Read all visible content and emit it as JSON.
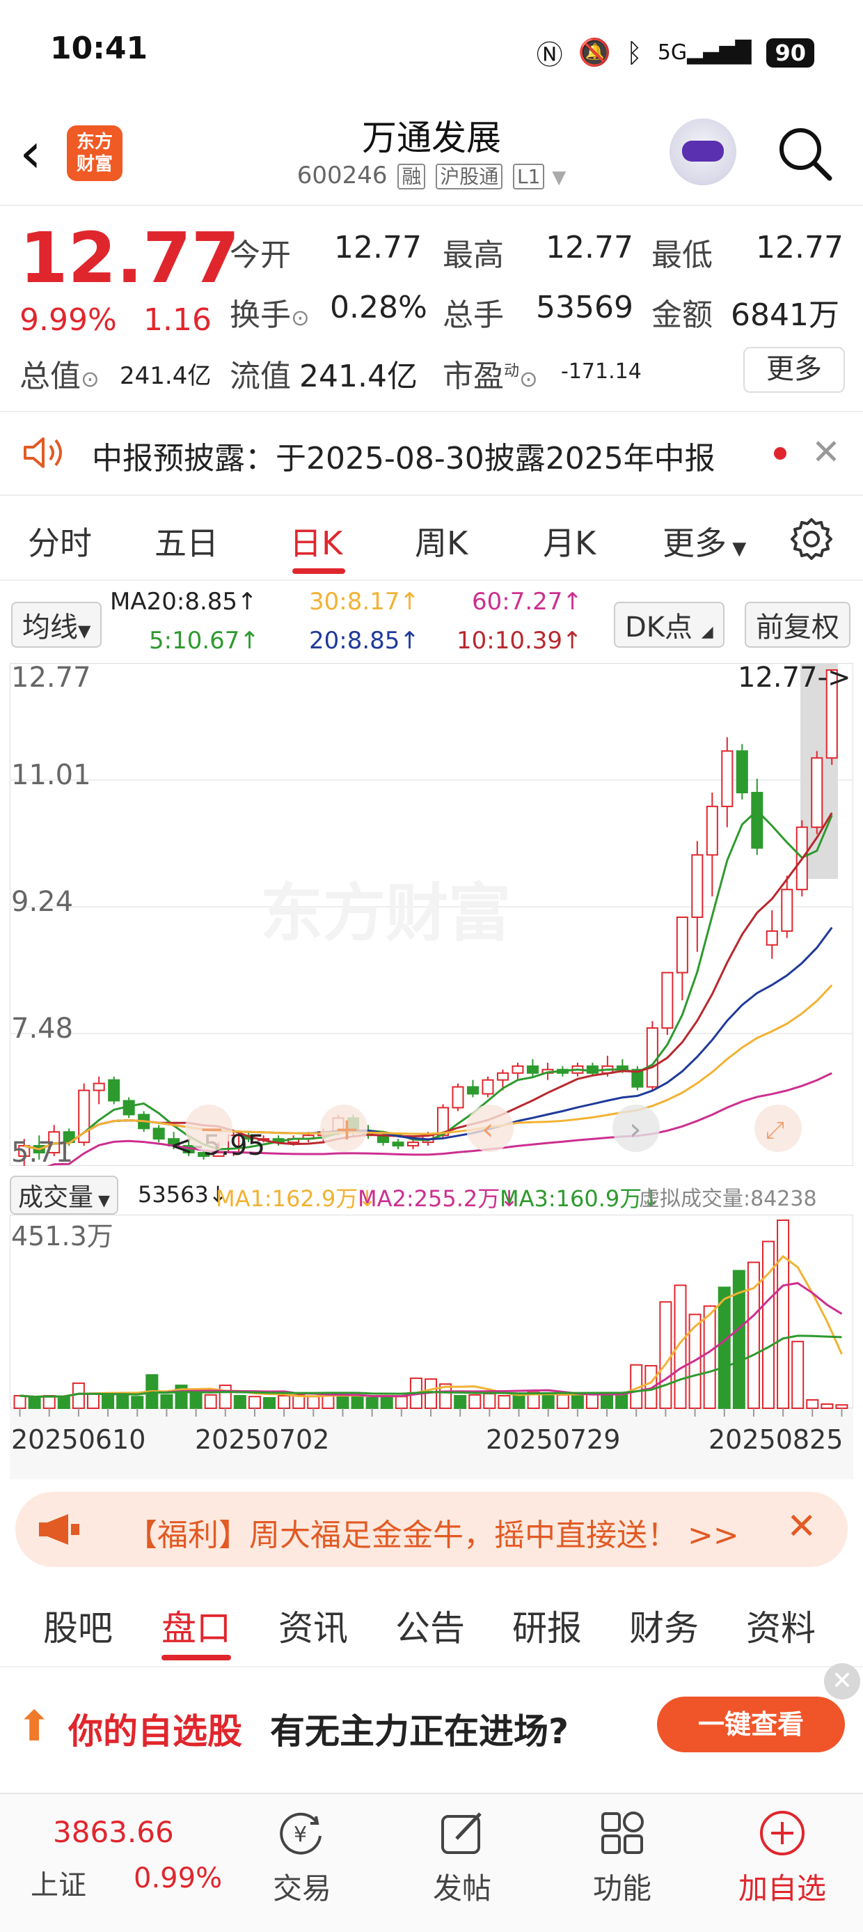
{
  "status_bar": {
    "time": "10:41",
    "network": "5G",
    "battery": "90"
  },
  "header": {
    "title": "万通发展",
    "code": "600246",
    "tags": [
      "融",
      "沪股通",
      "L1"
    ]
  },
  "quote": {
    "price": "12.77",
    "change_pct": "9.99%",
    "change": "1.16",
    "fields": [
      {
        "label": "今开",
        "value": "12.77"
      },
      {
        "label": "最高",
        "value": "12.77"
      },
      {
        "label": "最低",
        "value": "12.77"
      },
      {
        "label": "换手",
        "value": "0.28%"
      },
      {
        "label": "总手",
        "value": "53569"
      },
      {
        "label": "金额",
        "value": "6841万"
      },
      {
        "label": "总值",
        "value": "241.4亿"
      },
      {
        "label": "流值",
        "value": "241.4亿"
      },
      {
        "label": "市盈",
        "value": "-171.14",
        "sup": "动"
      }
    ],
    "more_label": "更多"
  },
  "notice": {
    "text": "中报预披露：于2025-08-30披露2025年中报"
  },
  "chart_tabs": [
    "分时",
    "五日",
    "日K",
    "周K",
    "月K",
    "更多"
  ],
  "ma_bar": {
    "selector": "均线",
    "ma20_top": "MA20:8.85↑",
    "ma30": "30:8.17↑",
    "ma60": "60:7.27↑",
    "ma5": "5:10.67↑",
    "ma20": "20:8.85↑",
    "ma10": "10:10.39↑",
    "dk_label": "DK点",
    "fq_label": "前复权"
  },
  "kline": {
    "price_labels": [
      "12.77",
      "11.01",
      "9.24",
      "7.48",
      "5.71"
    ],
    "current_marker": "12.77->",
    "low_marker": "<-5.95",
    "watermark": "东方财富"
  },
  "volume_bar": {
    "selector": "成交量",
    "vol": "53563↓",
    "ma1": "MA1:162.9万↓",
    "ma2": "MA2:255.2万↓",
    "ma3": "MA3:160.9万↓",
    "virtual": "虚拟成交量:84238",
    "max_label": "451.3万",
    "dates": [
      "20250610",
      "20250702",
      "20250729",
      "20250825"
    ]
  },
  "ad_banner": {
    "text": "【福利】周大福足金金牛，摇中直接送！ >>"
  },
  "sub_tabs": [
    "股吧",
    "盘口",
    "资讯",
    "公告",
    "研报",
    "财务",
    "资料"
  ],
  "promo": {
    "text_red": "你的自选股",
    "text_black": "有无主力正在进场?",
    "button": "一键查看"
  },
  "bottom_nav": {
    "index_value": "3863.66",
    "index_name": "上证",
    "index_change": "0.99%",
    "items": [
      "交易",
      "发帖",
      "功能",
      "加自选"
    ]
  },
  "colors": {
    "up": "#e0262d",
    "down": "#2d9a2e",
    "ma5": "#2d9a2e",
    "ma10": "#b8282e",
    "ma20": "#1f3a9a",
    "ma30": "#f2b233",
    "ma60": "#cc2f8f"
  },
  "candles": [
    [
      5.75,
      6.0,
      5.6,
      5.9
    ],
    [
      5.9,
      6.05,
      5.7,
      5.8
    ],
    [
      5.8,
      6.2,
      5.75,
      6.1
    ],
    [
      6.1,
      6.15,
      5.9,
      5.95
    ],
    [
      5.95,
      6.8,
      5.9,
      6.7
    ],
    [
      6.7,
      6.9,
      6.5,
      6.8
    ],
    [
      6.85,
      6.9,
      6.5,
      6.55
    ],
    [
      6.55,
      6.6,
      6.3,
      6.35
    ],
    [
      6.35,
      6.4,
      6.1,
      6.15
    ],
    [
      6.15,
      6.2,
      5.95,
      6.0
    ],
    [
      6.0,
      6.1,
      5.85,
      5.9
    ],
    [
      5.9,
      6.0,
      5.75,
      5.8
    ],
    [
      5.8,
      5.85,
      5.7,
      5.75
    ],
    [
      5.75,
      5.8,
      5.95,
      5.8
    ],
    [
      5.8,
      6.1,
      5.75,
      6.05
    ],
    [
      6.05,
      6.1,
      5.95,
      6.0
    ],
    [
      6.0,
      6.05,
      5.95,
      6.0
    ],
    [
      6.0,
      6.05,
      5.9,
      5.95
    ],
    [
      5.95,
      6.05,
      5.9,
      6.0
    ],
    [
      6.0,
      6.1,
      5.95,
      6.05
    ],
    [
      6.05,
      6.15,
      5.95,
      6.1
    ],
    [
      6.1,
      6.35,
      6.05,
      6.3
    ],
    [
      6.3,
      6.35,
      6.05,
      6.1
    ],
    [
      6.1,
      6.2,
      6.0,
      6.05
    ],
    [
      6.05,
      6.1,
      5.9,
      5.95
    ],
    [
      5.95,
      6.0,
      5.85,
      5.9
    ],
    [
      5.9,
      6.0,
      5.85,
      5.95
    ],
    [
      5.95,
      6.1,
      5.9,
      6.05
    ],
    [
      6.05,
      6.5,
      6.0,
      6.45
    ],
    [
      6.45,
      6.8,
      6.4,
      6.75
    ],
    [
      6.75,
      6.85,
      6.6,
      6.65
    ],
    [
      6.65,
      6.9,
      6.6,
      6.85
    ],
    [
      6.85,
      7.0,
      6.7,
      6.95
    ],
    [
      6.95,
      7.1,
      6.85,
      7.05
    ],
    [
      7.05,
      7.15,
      6.9,
      6.95
    ],
    [
      6.95,
      7.1,
      6.85,
      7.0
    ],
    [
      7.0,
      7.05,
      6.9,
      6.95
    ],
    [
      6.95,
      7.1,
      6.9,
      7.05
    ],
    [
      7.05,
      7.1,
      6.9,
      6.95
    ],
    [
      6.95,
      7.2,
      6.9,
      7.05
    ],
    [
      7.05,
      7.15,
      6.95,
      7.0
    ],
    [
      7.0,
      7.05,
      6.7,
      6.75
    ],
    [
      6.75,
      7.7,
      6.7,
      7.6
    ],
    [
      7.6,
      8.4,
      7.5,
      8.4
    ],
    [
      8.4,
      9.2,
      8.0,
      9.2
    ],
    [
      9.2,
      10.3,
      8.7,
      10.1
    ],
    [
      10.1,
      11.0,
      9.5,
      10.8
    ],
    [
      10.8,
      11.8,
      10.5,
      11.6
    ],
    [
      11.6,
      11.7,
      10.9,
      11.0
    ],
    [
      11.0,
      11.2,
      10.1,
      10.2
    ],
    [
      8.8,
      9.3,
      8.6,
      9.0
    ],
    [
      9.0,
      9.8,
      8.9,
      9.6
    ],
    [
      9.6,
      10.6,
      9.5,
      10.5
    ],
    [
      10.5,
      11.6,
      10.4,
      11.5
    ],
    [
      11.5,
      12.77,
      11.4,
      12.77
    ]
  ],
  "volumes": [
    0.3,
    0.25,
    0.3,
    0.28,
    0.6,
    0.35,
    0.3,
    0.32,
    0.28,
    0.8,
    0.32,
    0.55,
    0.35,
    0.32,
    0.55,
    0.3,
    0.28,
    0.25,
    0.3,
    0.32,
    0.28,
    0.35,
    0.3,
    0.28,
    0.25,
    0.3,
    0.28,
    0.72,
    0.7,
    0.58,
    0.3,
    0.32,
    0.35,
    0.3,
    0.32,
    0.38,
    0.35,
    0.32,
    0.3,
    0.35,
    0.36,
    0.32,
    1.04,
    1.02,
    2.55,
    2.95,
    2.25,
    2.45,
    2.9,
    3.3,
    3.5,
    4.0,
    4.51,
    1.6,
    0.2,
    0.1,
    0.08
  ]
}
